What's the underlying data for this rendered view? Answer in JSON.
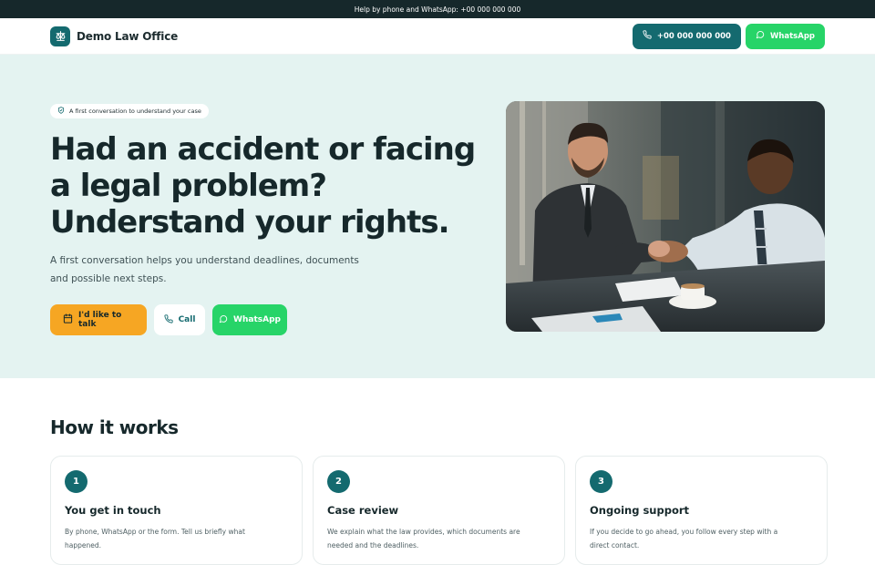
{
  "topbar": {
    "text": "Help by phone and WhatsApp: +00 000 000 000"
  },
  "header": {
    "logo_text": "Demo Law Office",
    "phone_label": "+00 000 000 000",
    "whatsapp_label": "WhatsApp"
  },
  "hero": {
    "pill": "A first conversation to understand your case",
    "title": "Had an accident or facing a legal problem? Understand your rights.",
    "subtitle": "A first conversation helps you understand deadlines, documents and possible next steps.",
    "cta_talk": "I'd like to talk",
    "cta_call": "Call",
    "cta_whatsapp": "WhatsApp"
  },
  "how": {
    "title": "How it works",
    "steps": [
      {
        "num": "1",
        "title": "You get in touch",
        "text": "By phone, WhatsApp or the form. Tell us briefly what happened."
      },
      {
        "num": "2",
        "title": "Case review",
        "text": "We explain what the law provides, which documents are needed and the deadlines."
      },
      {
        "num": "3",
        "title": "Ongoing support",
        "text": "If you decide to go ahead, you follow every step with a direct contact."
      }
    ]
  },
  "colors": {
    "brand": "#146a6f",
    "accent": "#f6a623",
    "whatsapp": "#27d468",
    "hero_bg": "#e4f3f1",
    "dark": "#16282b"
  }
}
